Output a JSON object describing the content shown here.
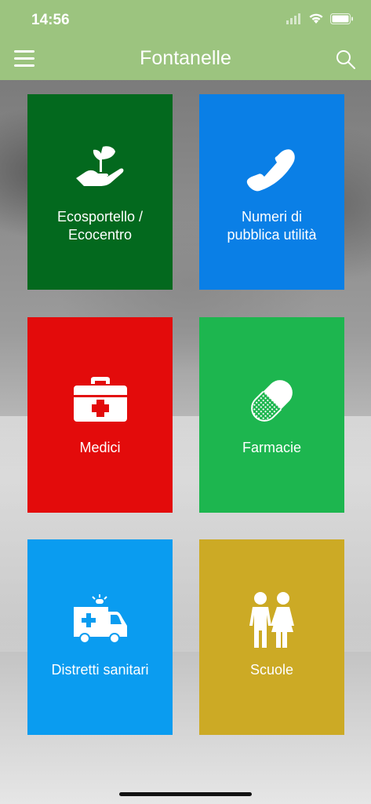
{
  "status_bar": {
    "time": "14:56"
  },
  "navbar": {
    "title": "Fontanelle"
  },
  "tiles": [
    {
      "label": "Ecosportello / Ecocentro",
      "color": "#03691e",
      "icon": "hand-plant-icon"
    },
    {
      "label": "Numeri di pubblica utilità",
      "color": "#0a7fe6",
      "icon": "phone-icon"
    },
    {
      "label": "Medici",
      "color": "#e30b0b",
      "icon": "first-aid-kit-icon"
    },
    {
      "label": "Farmacie",
      "color": "#1db64f",
      "icon": "pill-icon"
    },
    {
      "label": "Distretti sanitari",
      "color": "#0a9cf0",
      "icon": "ambulance-icon"
    },
    {
      "label": "Scuole",
      "color": "#ccaa25",
      "icon": "children-icon"
    }
  ]
}
